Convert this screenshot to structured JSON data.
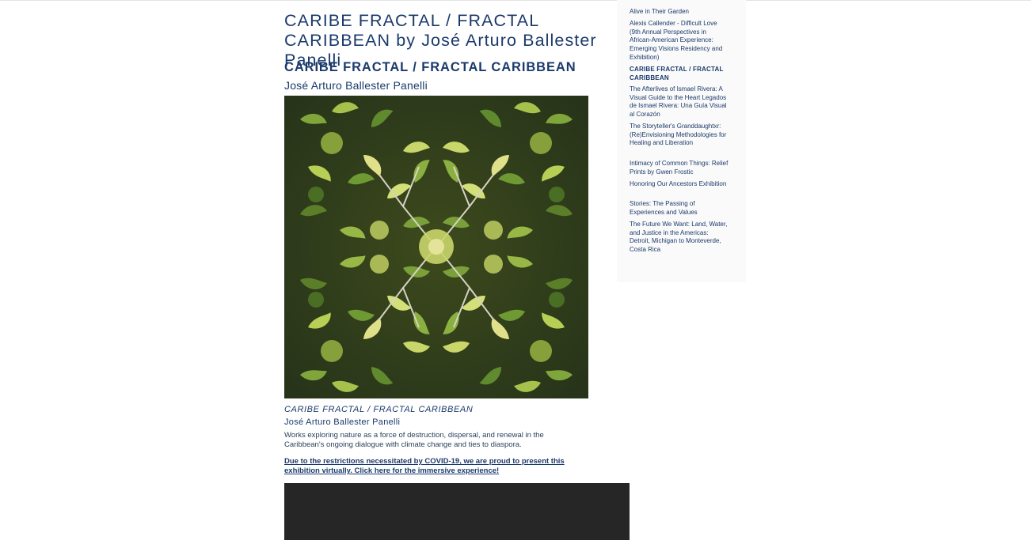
{
  "page": {
    "title": "CARIBE FRACTAL / FRACTAL CARIBBEAN by José Arturo Ballester Panelli",
    "section_heading": "CARIBE FRACTAL / FRACTAL CARIBBEAN",
    "artist": "José Arturo Ballester Panelli"
  },
  "artwork": {
    "icon": "artwork-image"
  },
  "caption": {
    "title": "CARIBE FRACTAL / FRACTAL CARIBBEAN",
    "artist": "José Arturo Ballester Panelli",
    "body": "Works exploring nature as a force of destruction, dispersal, and renewal in the Caribbean's ongoing dialogue with climate change and ties to diaspora."
  },
  "notice": {
    "text": "Due to the restrictions necessitated by COVID-19, we are proud to present this exhibition virtually. Click here for the immersive experience!"
  },
  "sidebar": {
    "items": [
      {
        "label": "Alive in Their Garden",
        "active": false
      },
      {
        "label": "Alexis Callender - Difficult Love (9th Annual Perspectives in African-American Experience: Emerging Visions Residency and Exhibition)",
        "active": false
      },
      {
        "label": "CARIBE FRACTAL / FRACTAL CARIBBEAN",
        "active": true
      },
      {
        "label": "The Afterlives of Ismael Rivera: A Visual Guide to the Heart Legados de Ismael Rivera: Una Guía Visual al Corazón",
        "active": false
      },
      {
        "label": "The Storyteller's Granddaughtxr: (Re)Envisioning Methodologies for Healing and Liberation",
        "active": false
      },
      {
        "label": "Intimacy of Common Things: Relief Prints by Gwen Frostic",
        "active": false
      },
      {
        "label": "Honoring Our Ancestors Exhibition",
        "active": false
      },
      {
        "label": "Stories: The Passing of Experiences and Values",
        "active": false
      },
      {
        "label": "The Future We Want: Land, Water, and Justice in the Americas: Detroit, Michigan to Monteverde, Costa Rica",
        "active": false
      }
    ]
  }
}
